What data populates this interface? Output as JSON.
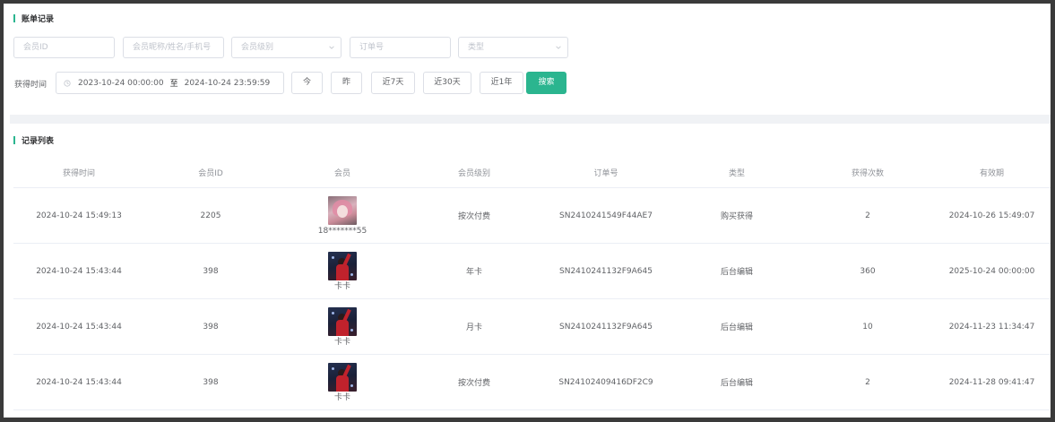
{
  "section1": {
    "title": "账单记录"
  },
  "filters": {
    "member_id_placeholder": "会员ID",
    "member_name_placeholder": "会员昵称/姓名/手机号",
    "member_level_placeholder": "会员级别",
    "order_no_placeholder": "订单号",
    "type_placeholder": "类型",
    "time_label": "获得时间",
    "date_start": "2023-10-24 00:00:00",
    "date_sep": "至",
    "date_end": "2024-10-24 23:59:59",
    "btn_today": "今",
    "btn_yesterday": "昨",
    "btn_7d": "近7天",
    "btn_30d": "近30天",
    "btn_1y": "近1年",
    "btn_search": "搜索"
  },
  "section2": {
    "title": "记录列表"
  },
  "table": {
    "headers": [
      "获得时间",
      "会员ID",
      "会员",
      "会员级别",
      "订单号",
      "类型",
      "获得次数",
      "有效期"
    ],
    "rows": [
      {
        "time": "2024-10-24 15:49:13",
        "member_id": "2205",
        "member_name": "18*******55",
        "level": "按次付费",
        "order_no": "SN2410241549F44AE7",
        "type": "购买获得",
        "count": "2",
        "expiry": "2024-10-26 15:49:07"
      },
      {
        "time": "2024-10-24 15:43:44",
        "member_id": "398",
        "member_name": "卡卡",
        "level": "年卡",
        "order_no": "SN2410241132F9A645",
        "type": "后台编辑",
        "count": "360",
        "expiry": "2025-10-24 00:00:00"
      },
      {
        "time": "2024-10-24 15:43:44",
        "member_id": "398",
        "member_name": "卡卡",
        "level": "月卡",
        "order_no": "SN2410241132F9A645",
        "type": "后台编辑",
        "count": "10",
        "expiry": "2024-11-23 11:34:47"
      },
      {
        "time": "2024-10-24 15:43:44",
        "member_id": "398",
        "member_name": "卡卡",
        "level": "按次付费",
        "order_no": "SN24102409416DF2C9",
        "type": "后台编辑",
        "count": "2",
        "expiry": "2024-11-28 09:41:47"
      }
    ]
  },
  "colors": {
    "accent": "#2bb58f",
    "band": "#f0f2f5"
  }
}
